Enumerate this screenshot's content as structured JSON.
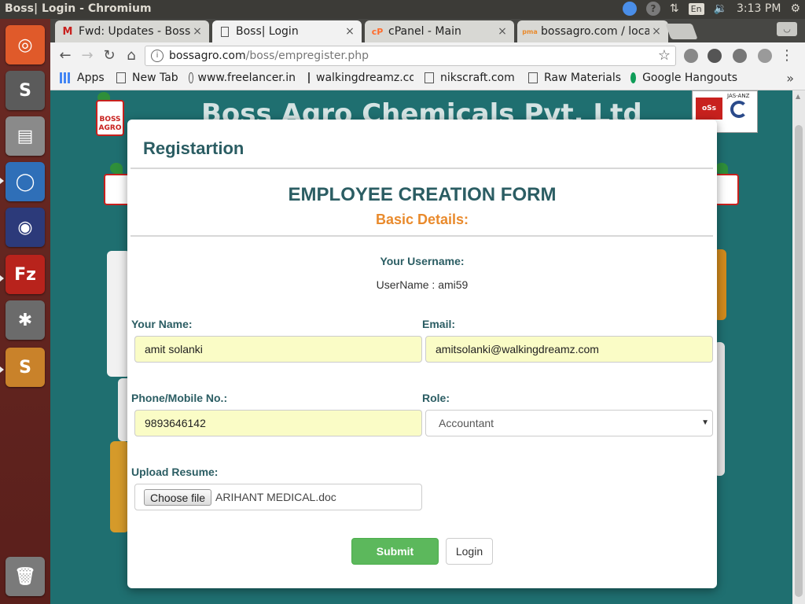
{
  "system_bar": {
    "window_title": "Boss| Login - Chromium",
    "keyboard_layout": "En",
    "clock": "3:13 PM"
  },
  "launcher": {
    "items": [
      "ubuntu-logo-icon",
      "sublime-text-icon",
      "files-icon",
      "chromium-icon",
      "firefox-icon",
      "filezilla-icon",
      "system-settings-icon",
      "sublime-text-icon",
      "trash-icon"
    ],
    "sublime_letter": "S",
    "filezilla_letters": "Fz"
  },
  "browser": {
    "tabs": [
      {
        "label": "Fwd: Updates - Boss",
        "favicon": "M",
        "active": false
      },
      {
        "label": "Boss| Login",
        "favicon": "page",
        "active": true
      },
      {
        "label": "cPanel - Main",
        "favicon": "cP",
        "active": false
      },
      {
        "label": "bossagro.com / localhost",
        "favicon": "pma",
        "active": false
      }
    ],
    "close_glyph": "×",
    "url_host": "bossagro.com",
    "url_path": "/boss/empregister.php",
    "bookmarks": [
      {
        "label": "Apps",
        "icon": "apps-icon"
      },
      {
        "label": "New Tab",
        "icon": "page-icon"
      },
      {
        "label": "www.freelancer.in",
        "icon": "freelancer-icon"
      },
      {
        "label": "walkingdreamz.com",
        "icon": "page-icon"
      },
      {
        "label": "nikscraft.com",
        "icon": "page-icon"
      },
      {
        "label": "Raw Materials",
        "icon": "page-icon"
      },
      {
        "label": "Google Hangouts",
        "icon": "hangouts-icon"
      }
    ],
    "overflow_glyph": "»"
  },
  "page": {
    "banner_title": "Boss Agro Chemicals Pvt. Ltd",
    "logo_text": "BOSS AGRO",
    "cert": {
      "oss": "oSs",
      "jas": "JAS-ANZ"
    }
  },
  "modal": {
    "title": "Registartion",
    "heading": "EMPLOYEE CREATION FORM",
    "subheading": "Basic Details:",
    "username_label": "Your Username:",
    "username_value": "UserName : ami59",
    "fields": {
      "name": {
        "label": "Your Name:",
        "value": "amit solanki"
      },
      "email": {
        "label": "Email:",
        "value": "amitsolanki@walkingdreamz.com"
      },
      "phone": {
        "label": "Phone/Mobile No.:",
        "value": "9893646142"
      },
      "role": {
        "label": "Role:",
        "selected": "Accountant"
      },
      "resume": {
        "label": "Upload Resume:",
        "button": "Choose file",
        "filename": "ARIHANT MEDICAL.doc"
      }
    },
    "submit_label": "Submit",
    "login_label": "Login"
  },
  "colors": {
    "accent_teal": "#2b5d63",
    "accent_orange": "#e98a2c",
    "submit_green": "#5cb85c",
    "autofill_yellow": "#fafcc6",
    "page_background": "#1f6f70"
  }
}
